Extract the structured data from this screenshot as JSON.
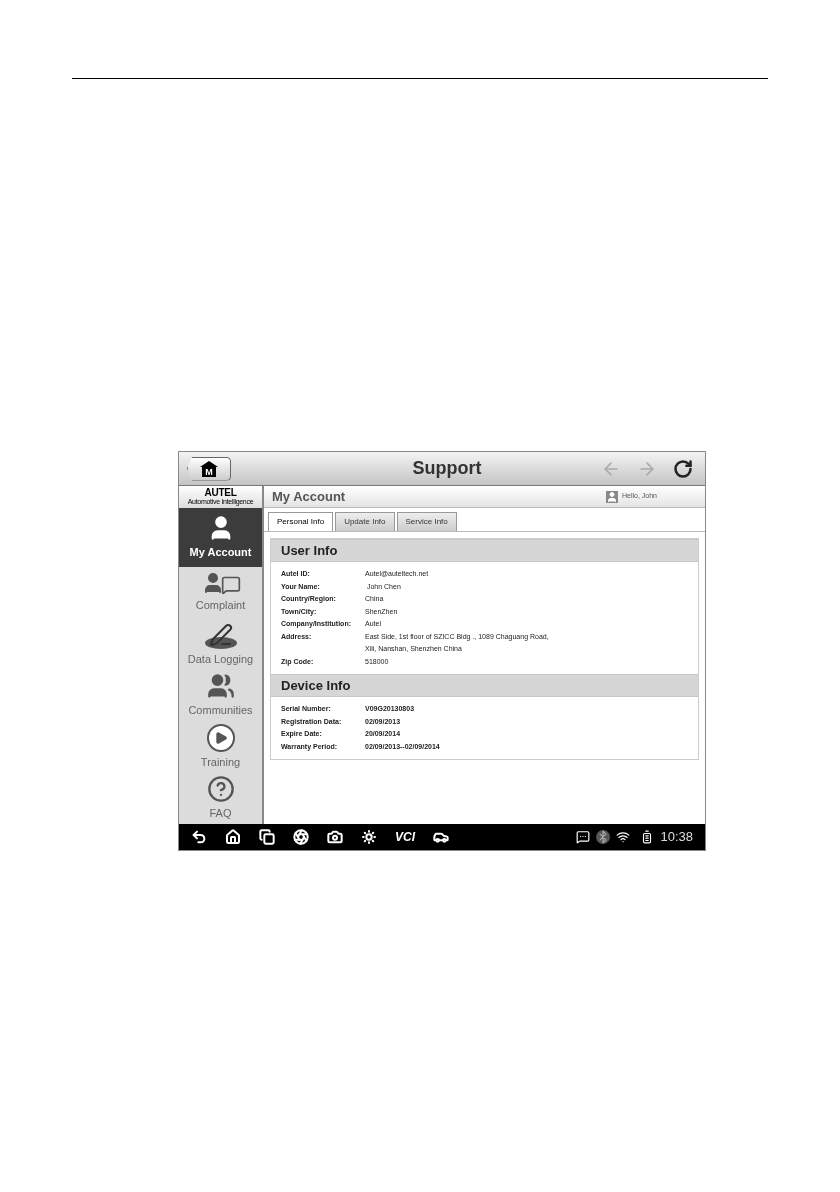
{
  "header": {
    "home_button": "M",
    "title": "Support"
  },
  "brand": {
    "name": "AUTEL",
    "tagline": "Automotive Intelligence"
  },
  "page": {
    "title": "My Account",
    "greeting": "Hello, John"
  },
  "sidebar": {
    "items": [
      {
        "kind": "user",
        "label": "My Account",
        "selected": true
      },
      {
        "kind": "complaint",
        "label": "Complaint",
        "selected": false
      },
      {
        "kind": "logging",
        "label": "Data Logging",
        "selected": false
      },
      {
        "kind": "group",
        "label": "Communities",
        "selected": false
      },
      {
        "kind": "play",
        "label": "Training",
        "selected": false
      },
      {
        "kind": "help",
        "label": "FAQ",
        "selected": false
      }
    ]
  },
  "tabs": [
    {
      "label": "Personal Info",
      "selected": true
    },
    {
      "label": "Update Info",
      "selected": false
    },
    {
      "label": "Service Info",
      "selected": false
    }
  ],
  "sections": [
    {
      "title": "User Info",
      "bold_values": false,
      "rows": [
        {
          "label": "Autel ID:",
          "value": "Autel@auteltech.net"
        },
        {
          "label": "Your Name:",
          "value": " John Chen"
        },
        {
          "label": "Country/Region:",
          "value": "China"
        },
        {
          "label": "Town/City:",
          "value": "ShenZhen"
        },
        {
          "label": "Company/Institution:",
          "value": "Autel"
        },
        {
          "label": "Address:",
          "value": "East Side, 1st floor of SZICC Bldg ., 1089 Chaguang Road,"
        },
        {
          "label": "",
          "value": "Xili, Nanshan, Shenzhen China"
        },
        {
          "label": "Zip Code:",
          "value": "518000"
        }
      ]
    },
    {
      "title": "Device Info",
      "bold_values": true,
      "rows": [
        {
          "label": "Serial Number:",
          "value": "V09G20130803"
        },
        {
          "label": "Registration Data:",
          "value": "02/09/2013"
        },
        {
          "label": "Expire Date:",
          "value": "20/09/2014"
        },
        {
          "label": "Warranty Period:",
          "value": "02/09/2013--02/09/2014"
        }
      ]
    }
  ],
  "status_bar": {
    "vci": "VCI",
    "time": "10:38"
  }
}
